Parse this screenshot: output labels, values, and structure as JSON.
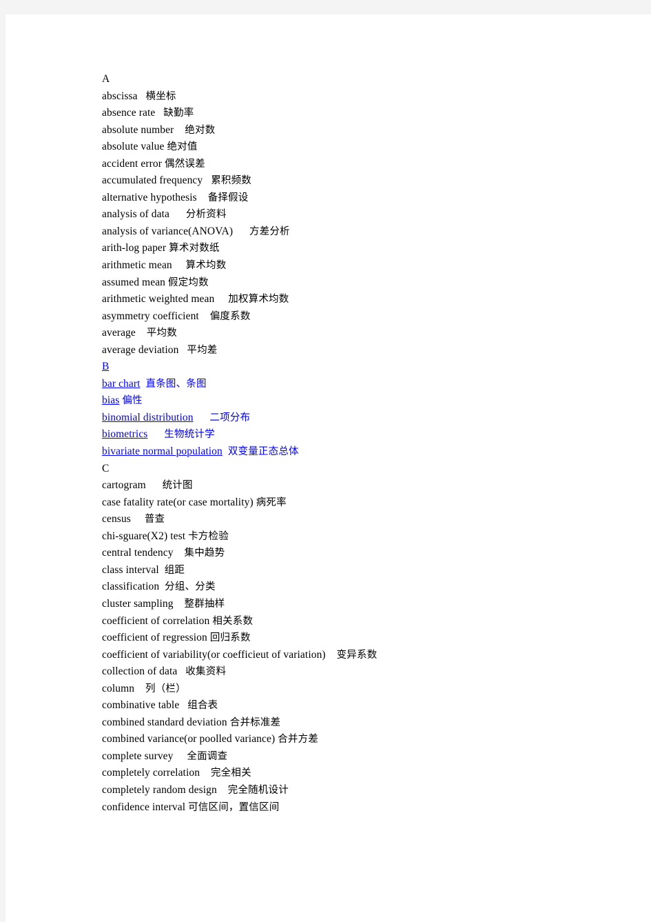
{
  "document": {
    "type": "glossary-page",
    "page_background": "#ffffff",
    "canvas_background": "#f4f4f4",
    "body_text_color": "#000000",
    "link_text_color": "#0000ff",
    "sections": [
      {
        "letter": "A",
        "is_link": false,
        "entries": [
          {
            "en": "abscissa",
            "gap": "   ",
            "cn": "横坐标"
          },
          {
            "en": "absence rate",
            "gap": "   ",
            "cn": "缺勤率"
          },
          {
            "en": "absolute number",
            "gap": "    ",
            "cn": "绝对数"
          },
          {
            "en": "absolute value",
            "gap": " ",
            "cn": "绝对值"
          },
          {
            "en": "accident error",
            "gap": " ",
            "cn": "偶然误差"
          },
          {
            "en": "accumulated frequency",
            "gap": "   ",
            "cn": "累积频数"
          },
          {
            "en": "alternative hypothesis",
            "gap": "    ",
            "cn": "备择假设"
          },
          {
            "en": "analysis of data",
            "gap": "      ",
            "cn": "分析资料"
          },
          {
            "en": "analysis of variance(ANOVA)",
            "gap": "      ",
            "cn": "方差分析"
          },
          {
            "en": "arith-log paper",
            "gap": " ",
            "cn": "算术对数纸"
          },
          {
            "en": "arithmetic mean",
            "gap": "     ",
            "cn": "算术均数"
          },
          {
            "en": "assumed mean",
            "gap": " ",
            "cn": "假定均数"
          },
          {
            "en": "arithmetic weighted mean",
            "gap": "     ",
            "cn": "加权算术均数"
          },
          {
            "en": "asymmetry coefficient",
            "gap": "    ",
            "cn": "偏度系数"
          },
          {
            "en": "average",
            "gap": "    ",
            "cn": "平均数"
          },
          {
            "en": "average deviation",
            "gap": "   ",
            "cn": "平均差"
          }
        ]
      },
      {
        "letter": "B",
        "is_link": true,
        "entries": [
          {
            "en": "bar chart",
            "gap": "  ",
            "cn": "直条图、条图"
          },
          {
            "en": "bias",
            "gap": " ",
            "cn": "偏性"
          },
          {
            "en": "binomial distribution",
            "gap": "      ",
            "cn": "二项分布"
          },
          {
            "en": "biometrics",
            "gap": "      ",
            "cn": "生物统计学"
          },
          {
            "en": "bivariate normal population",
            "gap": "  ",
            "cn": "双变量正态总体"
          }
        ]
      },
      {
        "letter": "C",
        "is_link": false,
        "entries": [
          {
            "en": "cartogram",
            "gap": "      ",
            "cn": "统计图"
          },
          {
            "en": "case fatality rate(or case mortality)",
            "gap": " ",
            "cn": "病死率"
          },
          {
            "en": "census",
            "gap": "     ",
            "cn": "普查"
          },
          {
            "en": "chi-sguare(X2) test",
            "gap": " ",
            "cn": "卡方检验"
          },
          {
            "en": "central tendency",
            "gap": "    ",
            "cn": "集中趋势"
          },
          {
            "en": "class interval",
            "gap": "  ",
            "cn": "组距"
          },
          {
            "en": "classification",
            "gap": "  ",
            "cn": "分组、分类"
          },
          {
            "en": "cluster sampling",
            "gap": "    ",
            "cn": "整群抽样"
          },
          {
            "en": "coefficient of correlation",
            "gap": " ",
            "cn": "相关系数"
          },
          {
            "en": "coefficient of regression",
            "gap": " ",
            "cn": "回归系数"
          },
          {
            "en": "coefficient of variability(or coefficieut of variation)",
            "gap": "    ",
            "cn": "变异系数"
          },
          {
            "en": "collection of data",
            "gap": "   ",
            "cn": "收集资料"
          },
          {
            "en": "column",
            "gap": "    ",
            "cn": "列（栏）"
          },
          {
            "en": "combinative table",
            "gap": "   ",
            "cn": "组合表"
          },
          {
            "en": "combined standard deviation",
            "gap": " ",
            "cn": "合并标准差"
          },
          {
            "en": "combined variance(or poolled variance)",
            "gap": " ",
            "cn": "合并方差"
          },
          {
            "en": "complete survey",
            "gap": "     ",
            "cn": "全面调查"
          },
          {
            "en": "completely correlation",
            "gap": "    ",
            "cn": "完全相关"
          },
          {
            "en": "completely random design",
            "gap": "    ",
            "cn": "完全随机设计"
          },
          {
            "en": "confidence interval",
            "gap": " ",
            "cn": "可信区间，置信区间"
          }
        ]
      }
    ]
  }
}
